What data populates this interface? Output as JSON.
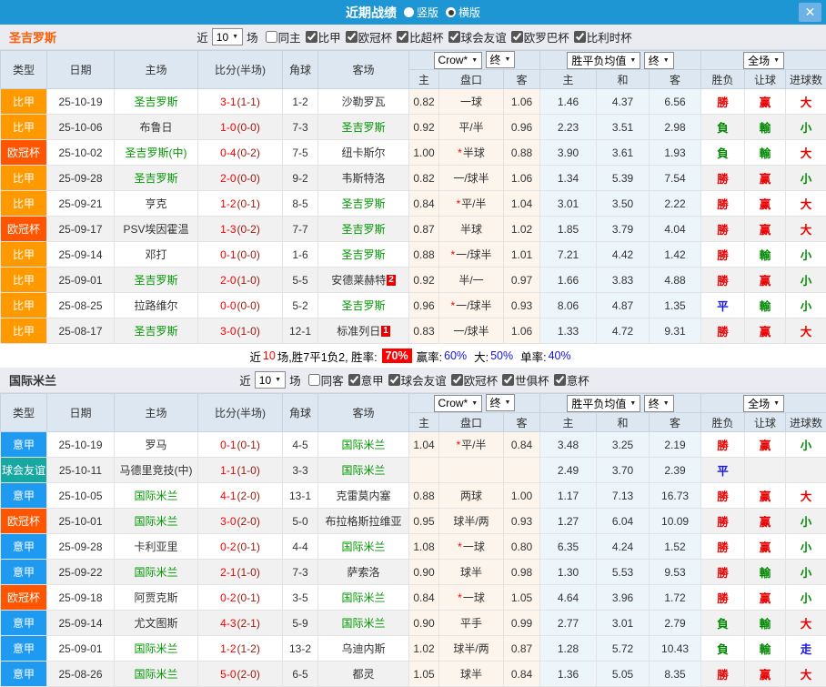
{
  "titlebar": {
    "title": "近期战绩",
    "radio_vertical": "竖版",
    "radio_horizontal": "横版",
    "close": "✕"
  },
  "filter_bar": {
    "near": "近",
    "count": "10",
    "games": "场"
  },
  "header": {
    "main": [
      "类型",
      "日期",
      "主场",
      "比分(半场)",
      "角球",
      "客场"
    ],
    "select_odds": "Crow*",
    "select_odds_final": "终",
    "select_mean": "胜平负均值",
    "select_mean_final": "终",
    "select_scope": "全场",
    "sub": [
      "主",
      "盘口",
      "客",
      "主",
      "和",
      "客",
      "胜负",
      "让球",
      "进球数"
    ]
  },
  "type_colors": {
    "比甲": "#ff9900",
    "欧冠杯": "#ff5400",
    "意甲": "#1e9af0",
    "球会友谊": "#17a8a3"
  },
  "result_colors": {
    "勝": "#e60000",
    "赢": "#e60000",
    "大": "#e60000",
    "負": "#008800",
    "輸": "#008800",
    "小": "#008800",
    "平": "#1414e6",
    "走": "#1414e6"
  },
  "sections": [
    {
      "team": "圣吉罗斯",
      "team_color": "#ff5a00",
      "filters": [
        {
          "label": "同主",
          "checked": false
        },
        {
          "label": "比甲",
          "checked": true
        },
        {
          "label": "欧冠杯",
          "checked": true
        },
        {
          "label": "比超杯",
          "checked": true
        },
        {
          "label": "球会友谊",
          "checked": true
        },
        {
          "label": "欧罗巴杯",
          "checked": true
        },
        {
          "label": "比利时杯",
          "checked": true
        }
      ],
      "rows": [
        {
          "type": "比甲",
          "date": "25-10-19",
          "home": "圣吉罗斯",
          "home_green": true,
          "score": "3-1",
          "half": "(1-1)",
          "corner": "1-2",
          "away": "沙勒罗瓦",
          "away_green": false,
          "odds": [
            "0.82",
            "一球",
            "1.06"
          ],
          "star": false,
          "mean": [
            "1.46",
            "4.37",
            "6.56"
          ],
          "res": [
            "勝",
            "赢",
            "大"
          ]
        },
        {
          "type": "比甲",
          "date": "25-10-06",
          "home": "布鲁日",
          "home_green": false,
          "score": "1-0",
          "half": "(0-0)",
          "corner": "7-3",
          "away": "圣吉罗斯",
          "away_green": true,
          "odds": [
            "0.92",
            "平/半",
            "0.96"
          ],
          "star": false,
          "mean": [
            "2.23",
            "3.51",
            "2.98"
          ],
          "res": [
            "負",
            "輸",
            "小"
          ]
        },
        {
          "type": "欧冠杯",
          "date": "25-10-02",
          "home": "圣吉罗斯(中)",
          "home_green": true,
          "score": "0-4",
          "half": "(0-2)",
          "corner": "7-5",
          "away": "纽卡斯尔",
          "away_green": false,
          "odds": [
            "1.00",
            "半球",
            "0.88"
          ],
          "star": true,
          "mean": [
            "3.90",
            "3.61",
            "1.93"
          ],
          "res": [
            "負",
            "輸",
            "大"
          ]
        },
        {
          "type": "比甲",
          "date": "25-09-28",
          "home": "圣吉罗斯",
          "home_green": true,
          "score": "2-0",
          "half": "(0-0)",
          "corner": "9-2",
          "away": "韦斯特洛",
          "away_green": false,
          "odds": [
            "0.82",
            "一/球半",
            "1.06"
          ],
          "star": false,
          "mean": [
            "1.34",
            "5.39",
            "7.54"
          ],
          "res": [
            "勝",
            "赢",
            "小"
          ]
        },
        {
          "type": "比甲",
          "date": "25-09-21",
          "home": "亨克",
          "home_green": false,
          "score": "1-2",
          "half": "(0-1)",
          "corner": "8-5",
          "away": "圣吉罗斯",
          "away_green": true,
          "odds": [
            "0.84",
            "平/半",
            "1.04"
          ],
          "star": true,
          "mean": [
            "3.01",
            "3.50",
            "2.22"
          ],
          "res": [
            "勝",
            "赢",
            "大"
          ]
        },
        {
          "type": "欧冠杯",
          "date": "25-09-17",
          "home": "PSV埃因霍温",
          "home_green": false,
          "score": "1-3",
          "half": "(0-2)",
          "corner": "7-7",
          "away": "圣吉罗斯",
          "away_green": true,
          "odds": [
            "0.87",
            "半球",
            "1.02"
          ],
          "star": false,
          "mean": [
            "1.85",
            "3.79",
            "4.04"
          ],
          "res": [
            "勝",
            "赢",
            "大"
          ]
        },
        {
          "type": "比甲",
          "date": "25-09-14",
          "home": "邓打",
          "home_green": false,
          "score": "0-1",
          "half": "(0-0)",
          "corner": "1-6",
          "away": "圣吉罗斯",
          "away_green": true,
          "odds": [
            "0.88",
            "一/球半",
            "1.01"
          ],
          "star": true,
          "mean": [
            "7.21",
            "4.42",
            "1.42"
          ],
          "res": [
            "勝",
            "輸",
            "小"
          ]
        },
        {
          "type": "比甲",
          "date": "25-09-01",
          "home": "圣吉罗斯",
          "home_green": true,
          "score": "2-0",
          "half": "(1-0)",
          "corner": "5-5",
          "away": "安德莱赫特",
          "away_green": false,
          "away_badge": "2",
          "odds": [
            "0.92",
            "半/一",
            "0.97"
          ],
          "star": false,
          "mean": [
            "1.66",
            "3.83",
            "4.88"
          ],
          "res": [
            "勝",
            "赢",
            "小"
          ]
        },
        {
          "type": "比甲",
          "date": "25-08-25",
          "home": "拉路维尔",
          "home_green": false,
          "score": "0-0",
          "half": "(0-0)",
          "corner": "5-2",
          "away": "圣吉罗斯",
          "away_green": true,
          "odds": [
            "0.96",
            "一/球半",
            "0.93"
          ],
          "star": true,
          "mean": [
            "8.06",
            "4.87",
            "1.35"
          ],
          "res": [
            "平",
            "輸",
            "小"
          ]
        },
        {
          "type": "比甲",
          "date": "25-08-17",
          "home": "圣吉罗斯",
          "home_green": true,
          "score": "3-0",
          "half": "(1-0)",
          "corner": "12-1",
          "away": "标准列日",
          "away_green": false,
          "away_badge": "1",
          "odds": [
            "0.83",
            "一/球半",
            "1.06"
          ],
          "star": false,
          "mean": [
            "1.33",
            "4.72",
            "9.31"
          ],
          "res": [
            "勝",
            "赢",
            "大"
          ]
        }
      ],
      "summary": {
        "near": "近",
        "count": "10",
        "mid": "场,胜7平1负2, 胜率:",
        "rate": "70%",
        "win_label": "赢率:",
        "win": "60%",
        "big_label": "大:",
        "big": "50%",
        "single_label": "单率:",
        "single": "40%"
      }
    },
    {
      "team": "国际米兰",
      "team_color": "#333333",
      "filters": [
        {
          "label": "同客",
          "checked": false
        },
        {
          "label": "意甲",
          "checked": true
        },
        {
          "label": "球会友谊",
          "checked": true
        },
        {
          "label": "欧冠杯",
          "checked": true
        },
        {
          "label": "世俱杯",
          "checked": true
        },
        {
          "label": "意杯",
          "checked": true
        }
      ],
      "rows": [
        {
          "type": "意甲",
          "date": "25-10-19",
          "home": "罗马",
          "home_green": false,
          "score": "0-1",
          "half": "(0-1)",
          "corner": "4-5",
          "away": "国际米兰",
          "away_green": true,
          "odds": [
            "1.04",
            "平/半",
            "0.84"
          ],
          "star": true,
          "mean": [
            "3.48",
            "3.25",
            "2.19"
          ],
          "res": [
            "勝",
            "赢",
            "小"
          ]
        },
        {
          "type": "球会友谊",
          "date": "25-10-11",
          "home": "马德里竞技(中)",
          "home_green": false,
          "score": "1-1",
          "half": "(1-0)",
          "corner": "3-3",
          "away": "国际米兰",
          "away_green": true,
          "odds": [
            "",
            "",
            ""
          ],
          "star": false,
          "mean": [
            "2.49",
            "3.70",
            "2.39"
          ],
          "res": [
            "平",
            "",
            ""
          ]
        },
        {
          "type": "意甲",
          "date": "25-10-05",
          "home": "国际米兰",
          "home_green": true,
          "score": "4-1",
          "half": "(2-0)",
          "corner": "13-1",
          "away": "克雷莫内塞",
          "away_green": false,
          "odds": [
            "0.88",
            "两球",
            "1.00"
          ],
          "star": false,
          "mean": [
            "1.17",
            "7.13",
            "16.73"
          ],
          "res": [
            "勝",
            "赢",
            "大"
          ]
        },
        {
          "type": "欧冠杯",
          "date": "25-10-01",
          "home": "国际米兰",
          "home_green": true,
          "score": "3-0",
          "half": "(2-0)",
          "corner": "5-0",
          "away": "布拉格斯拉维亚",
          "away_green": false,
          "odds": [
            "0.95",
            "球半/两",
            "0.93"
          ],
          "star": false,
          "mean": [
            "1.27",
            "6.04",
            "10.09"
          ],
          "res": [
            "勝",
            "赢",
            "小"
          ]
        },
        {
          "type": "意甲",
          "date": "25-09-28",
          "home": "卡利亚里",
          "home_green": false,
          "score": "0-2",
          "half": "(0-1)",
          "corner": "4-4",
          "away": "国际米兰",
          "away_green": true,
          "odds": [
            "1.08",
            "一球",
            "0.80"
          ],
          "star": true,
          "mean": [
            "6.35",
            "4.24",
            "1.52"
          ],
          "res": [
            "勝",
            "赢",
            "小"
          ]
        },
        {
          "type": "意甲",
          "date": "25-09-22",
          "home": "国际米兰",
          "home_green": true,
          "score": "2-1",
          "half": "(1-0)",
          "corner": "7-3",
          "away": "萨索洛",
          "away_green": false,
          "odds": [
            "0.90",
            "球半",
            "0.98"
          ],
          "star": false,
          "mean": [
            "1.30",
            "5.53",
            "9.53"
          ],
          "res": [
            "勝",
            "輸",
            "小"
          ]
        },
        {
          "type": "欧冠杯",
          "date": "25-09-18",
          "home": "阿贾克斯",
          "home_green": false,
          "score": "0-2",
          "half": "(0-1)",
          "corner": "3-5",
          "away": "国际米兰",
          "away_green": true,
          "odds": [
            "0.84",
            "一球",
            "1.05"
          ],
          "star": true,
          "mean": [
            "4.64",
            "3.96",
            "1.72"
          ],
          "res": [
            "勝",
            "赢",
            "小"
          ]
        },
        {
          "type": "意甲",
          "date": "25-09-14",
          "home": "尤文图斯",
          "home_green": false,
          "score": "4-3",
          "half": "(2-1)",
          "corner": "5-9",
          "away": "国际米兰",
          "away_green": true,
          "odds": [
            "0.90",
            "平手",
            "0.99"
          ],
          "star": false,
          "mean": [
            "2.77",
            "3.01",
            "2.79"
          ],
          "res": [
            "負",
            "輸",
            "大"
          ]
        },
        {
          "type": "意甲",
          "date": "25-09-01",
          "home": "国际米兰",
          "home_green": true,
          "score": "1-2",
          "half": "(1-2)",
          "corner": "13-2",
          "away": "乌迪内斯",
          "away_green": false,
          "odds": [
            "1.02",
            "球半/两",
            "0.87"
          ],
          "star": false,
          "mean": [
            "1.28",
            "5.72",
            "10.43"
          ],
          "res": [
            "負",
            "輸",
            "走"
          ]
        },
        {
          "type": "意甲",
          "date": "25-08-26",
          "home": "国际米兰",
          "home_green": true,
          "score": "5-0",
          "half": "(2-0)",
          "corner": "6-5",
          "away": "都灵",
          "away_green": false,
          "odds": [
            "1.05",
            "球半",
            "0.84"
          ],
          "star": false,
          "mean": [
            "1.36",
            "5.05",
            "8.35"
          ],
          "res": [
            "勝",
            "赢",
            "大"
          ]
        }
      ]
    }
  ]
}
